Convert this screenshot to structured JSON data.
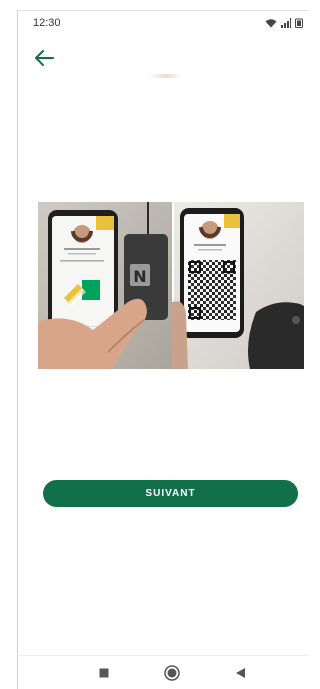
{
  "status_bar": {
    "time": "12:30",
    "icons": [
      "wifi-icon",
      "signal-icon",
      "battery-icon"
    ]
  },
  "header": {
    "back_icon": "arrow-left-icon"
  },
  "main": {
    "button_label": "SUIVANT",
    "illustration": {
      "nfc_symbol": "N"
    }
  },
  "nav_bar": {
    "icons": [
      "square-recents-icon",
      "circle-home-icon",
      "triangle-back-icon"
    ]
  },
  "colors": {
    "accent": "#11704a",
    "nfc_panel": "#00a35c",
    "id_badge": "#e8c23a"
  }
}
